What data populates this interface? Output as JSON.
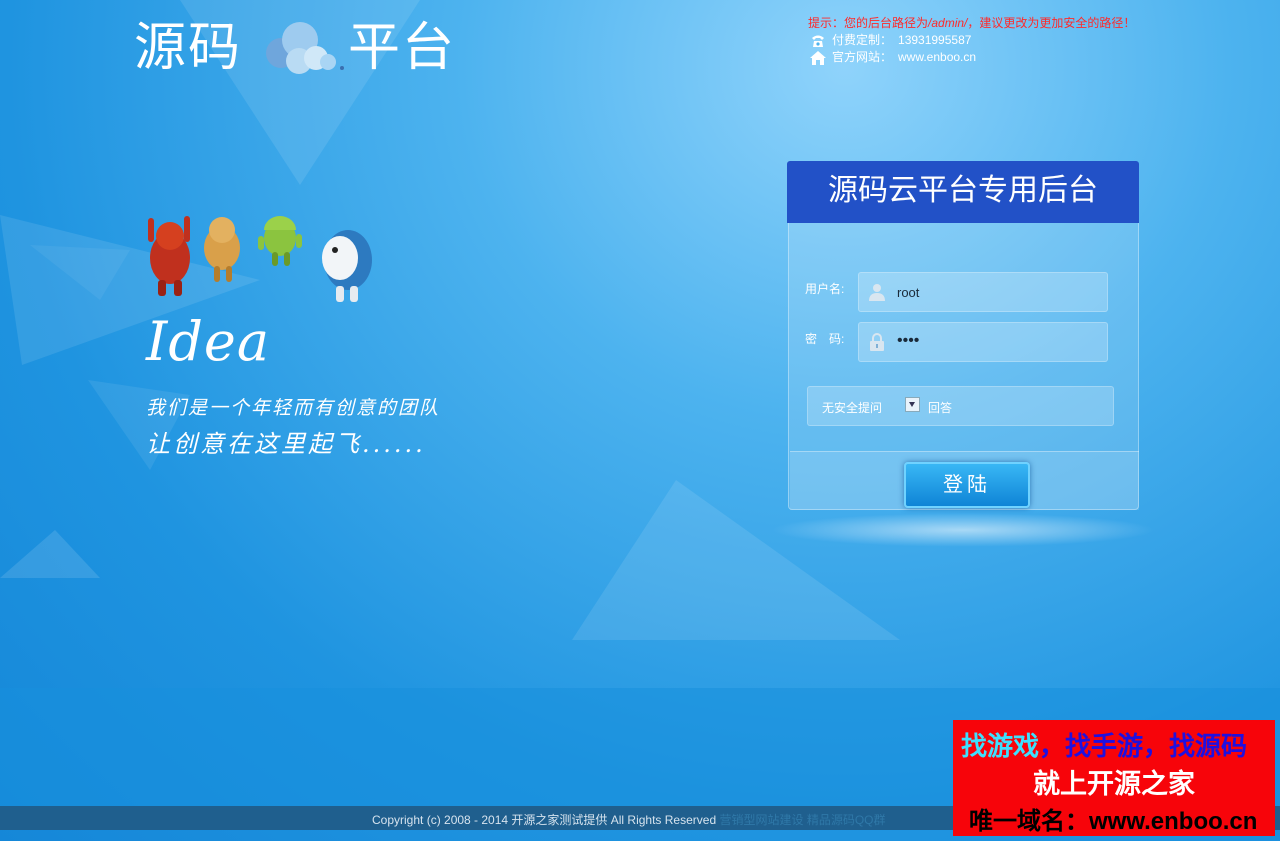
{
  "logo": {
    "left": "源码",
    "right": "平台"
  },
  "info": {
    "warning": "提示：您的后台路径为",
    "warning_path": "/admin/",
    "warning_suffix": "，建议更改为更加安全的路径！",
    "phone_label": "付费定制：",
    "phone": "13931995587",
    "site_label": "官方网站：",
    "site": "www.enboo.cn"
  },
  "hero": {
    "idea": "Idea",
    "slogan_line1": "我们是一个年轻而有创意的团队",
    "slogan_line2": "让创意在这里起飞......"
  },
  "login": {
    "title": "源码云平台专用后台",
    "username_label": "用户名:",
    "username_value": "root",
    "password_label": "密　码:",
    "password_value": "••••",
    "security_question": "无安全提问",
    "answer_label": "回答",
    "submit_label": "登陆"
  },
  "footer": {
    "copyright": "Copyright (c) 2008 - 2014 开源之家测试提供 All Rights Reserved",
    "link1": "营销型网站建设",
    "link2": "精品源码QQ群"
  },
  "ad": {
    "line1_a": "找游戏",
    "line1_b": "，找手游，找源码",
    "line2": "就上开源之家",
    "line3": "唯一域名：www.enboo.cn"
  },
  "colors": {
    "panel_header": "#2251c7",
    "background": "#1f94e0",
    "warning": "#ff2a2a",
    "ad_background": "#f7040a"
  }
}
